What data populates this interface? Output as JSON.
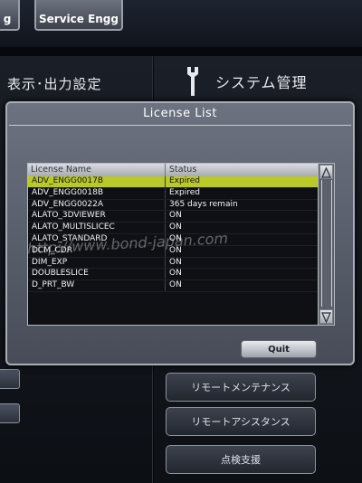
{
  "topbar": {
    "left_button_label": "g",
    "service_button_label": "Service Engg"
  },
  "sections": {
    "display_output_title": "表示･出力設定",
    "system_admin_title": "システム管理"
  },
  "side_buttons": [
    {
      "label": "リモートメンテナンス"
    },
    {
      "label": "リモートアシスタンス"
    },
    {
      "label": "点検支援"
    }
  ],
  "dialog": {
    "title": "License List",
    "columns": {
      "name": "License Name",
      "status": "Status"
    },
    "rows": [
      {
        "name": "ADV_ENGG0017B",
        "status": "Expired",
        "selected": true
      },
      {
        "name": "ADV_ENGG0018B",
        "status": "Expired"
      },
      {
        "name": "ADV_ENGG0022A",
        "status": "365 days remain"
      },
      {
        "name": "ALATO_3DVIEWER",
        "status": "ON"
      },
      {
        "name": "ALATO_MULTISLICEC",
        "status": "ON"
      },
      {
        "name": "ALATO_STANDARD",
        "status": "ON"
      },
      {
        "name": "DCM_CDR",
        "status": "ON"
      },
      {
        "name": "DIM_EXP",
        "status": "ON"
      },
      {
        "name": "DOUBLESLICE",
        "status": "ON"
      },
      {
        "name": "D_PRT_BW",
        "status": "ON"
      }
    ],
    "quit_label": "Quit"
  },
  "watermark": "http://www.bond-japan.com",
  "colors": {
    "selection": "#b9c92a",
    "dialog_bg": "#5c616d",
    "list_bg": "#0e1014"
  }
}
